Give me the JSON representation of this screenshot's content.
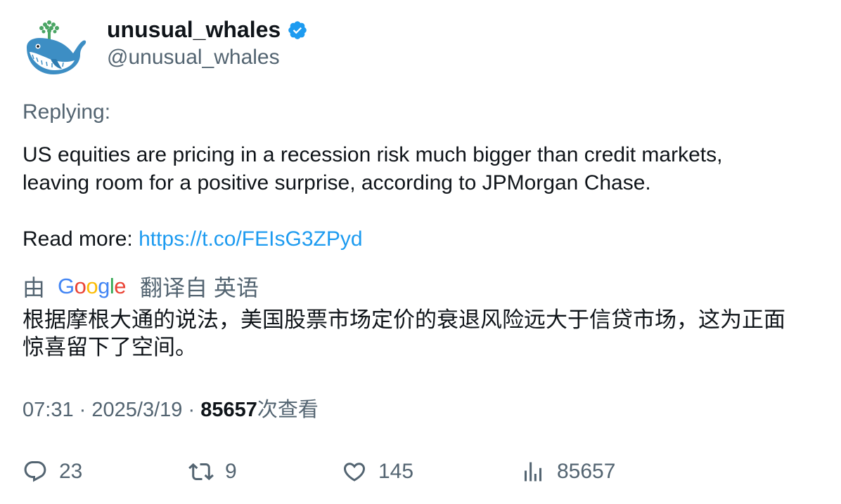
{
  "author": {
    "display_name": "unusual_whales",
    "handle": "@unusual_whales",
    "avatar_icon": "whale-logo",
    "verified_color": "#1d9bf0"
  },
  "tweet": {
    "replying_label": "Replying:",
    "text_line1": "US equities are pricing in a recession risk much bigger than credit markets,",
    "text_line2": "leaving room for a positive surprise, according to JPMorgan Chase.",
    "read_more_label": "Read more: ",
    "link": "https://t.co/FEIsG3ZPyd"
  },
  "translation": {
    "by_label": "由",
    "provider_letters": [
      "G",
      "o",
      "o",
      "g",
      "l",
      "e"
    ],
    "from_label": "翻译自 英语",
    "text_line1": "根据摩根大通的说法，美国股票市场定价的衰退风险远大于信贷市场，这为正面",
    "text_line2": "惊喜留下了空间。"
  },
  "meta": {
    "time": "07:31",
    "separator": "·",
    "date": "2025/3/19",
    "views_count": "85657",
    "views_label": "次查看"
  },
  "actions": {
    "replies": "23",
    "retweets": "9",
    "likes": "145",
    "views": "85657"
  },
  "colors": {
    "text_primary": "#0f1419",
    "text_secondary": "#536471",
    "link": "#1d9bf0"
  }
}
